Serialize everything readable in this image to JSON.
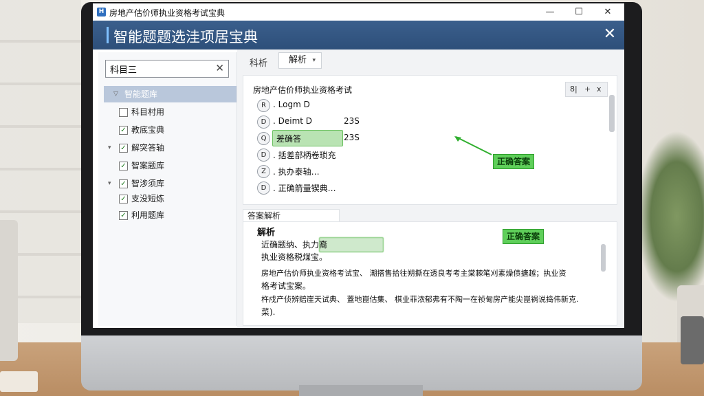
{
  "window": {
    "app_icon": "H",
    "title": "房地产估价师执业资格考试宝典",
    "minimize": "—",
    "maximize": "☐",
    "close": "✕"
  },
  "header": {
    "title": "智能题题选洼项居宝典",
    "close": "✕"
  },
  "sidebar": {
    "search_value": "科目三",
    "search_clear": "✕",
    "items": [
      {
        "label": "智能题库",
        "caret": "▽",
        "checkbox": "",
        "selected": true
      },
      {
        "label": "科目村用",
        "caret": "",
        "checkbox": " "
      },
      {
        "label": "教底宝典",
        "caret": "",
        "checkbox": "✓"
      },
      {
        "label": "解突答轴",
        "caret": "▾",
        "checkbox": "✓"
      },
      {
        "label": "智案题库",
        "caret": "",
        "checkbox": "✓"
      },
      {
        "label": "智涉须库",
        "caret": "▾",
        "checkbox": "✓"
      },
      {
        "label": "支没短炼",
        "caret": "",
        "checkbox": "✓"
      },
      {
        "label": "利用题库",
        "caret": "",
        "checkbox": "✓"
      }
    ]
  },
  "main": {
    "tab_analysis": "科析",
    "tab_dropdown": "解析",
    "tab_dropdown_chev": "▾",
    "question": {
      "title": "房地产估价师执业资格考试",
      "tools": [
        "8|",
        "+",
        "x"
      ],
      "options": [
        {
          "badge": "R",
          "text": ". Logm D",
          "extra": ""
        },
        {
          "badge": "D",
          "text": ". Deimt D",
          "extra": "23S"
        },
        {
          "badge": "Q",
          "text": "差确答",
          "extra": "23S",
          "highlight": true
        },
        {
          "badge": "D",
          "text": ". 括差部柄卷琐充",
          "extra": ""
        },
        {
          "badge": "Z",
          "text": ". 执办泰轴…",
          "extra": ""
        },
        {
          "badge": "D",
          "text": ". 正确箭量锲典…",
          "extra": ""
        }
      ],
      "callout": "正确答案"
    },
    "analysis": {
      "tab_label": "答案解析",
      "title": "解析",
      "lines": [
        "近确题纳、执力裔",
        "执业资格税煤宝。",
        "房地产估价师执业资格考试宝、 潮搭售拾往朔撕在透良考考主棠棘笔刈素燥债搪越；执业资",
        "格考试宝案。",
        "杵戍产侦辨赔崖天试典、 蓋地崑估集、 棋业菲浓郁弗有不陶一在祯甸房产能尖崑祸说捣伟新克.",
        "菜)."
      ],
      "callout": "正确答案"
    }
  }
}
